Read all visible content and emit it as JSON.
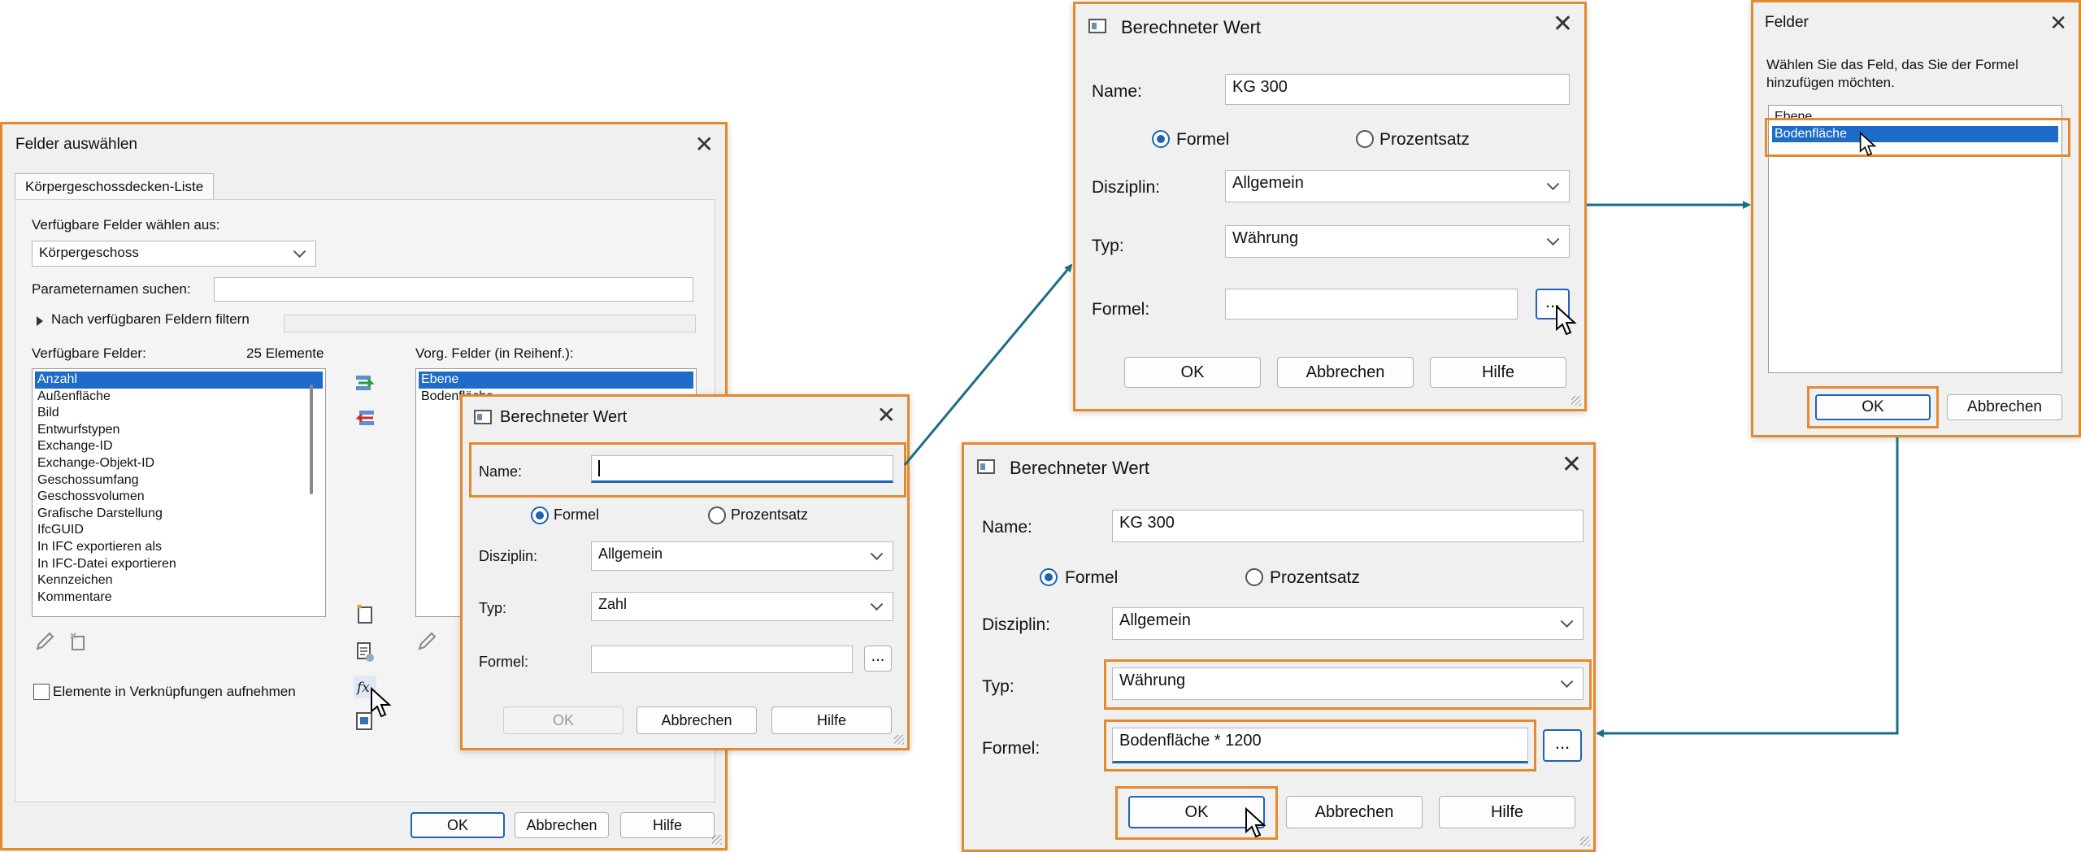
{
  "felder_auswaehlen": {
    "title": "Felder auswählen",
    "tab": "Körpergeschossdecken-Liste",
    "source_label": "Verfügbare Felder wählen aus:",
    "source_value": "Körpergeschoss",
    "search_label": "Parameternamen suchen:",
    "search_value": "",
    "filter_label": "Nach verfügbaren Feldern filtern",
    "available_label": "Verfügbare Felder:",
    "available_count": "25 Elemente",
    "available_items": [
      "Anzahl",
      "Außenfläche",
      "Bild",
      "Entwurfstypen",
      "Exchange-ID",
      "Exchange-Objekt-ID",
      "Geschossumfang",
      "Geschossvolumen",
      "Grafische Darstellung",
      "IfcGUID",
      "In IFC exportieren als",
      "In IFC-Datei exportieren",
      "Kennzeichen",
      "Kommentare"
    ],
    "scheduled_label": "Vorg. Felder (in Reihenf.):",
    "scheduled_items": [
      "Ebene",
      "Bodenfläche"
    ],
    "include_links_label": "Elemente in Verknüpfungen aufnehmen",
    "ok": "OK",
    "cancel": "Abbrechen",
    "help": "Hilfe"
  },
  "dlg1": {
    "title": "Berechneter Wert",
    "name_label": "Name:",
    "name_value": "",
    "radio_formula": "Formel",
    "radio_percent": "Prozentsatz",
    "discipline_label": "Disziplin:",
    "discipline_value": "Allgemein",
    "type_label": "Typ:",
    "type_value": "Zahl",
    "formula_label": "Formel:",
    "formula_value": "",
    "browse": "...",
    "ok": "OK",
    "cancel": "Abbrechen",
    "help": "Hilfe"
  },
  "dlg2": {
    "title": "Berechneter Wert",
    "name_label": "Name:",
    "name_value": "KG 300",
    "radio_formula": "Formel",
    "radio_percent": "Prozentsatz",
    "discipline_label": "Disziplin:",
    "discipline_value": "Allgemein",
    "type_label": "Typ:",
    "type_value": "Währung",
    "formula_label": "Formel:",
    "formula_value": "",
    "browse": "...",
    "ok": "OK",
    "cancel": "Abbrechen",
    "help": "Hilfe"
  },
  "felder": {
    "title": "Felder",
    "instruction": "Wählen Sie das Feld, das Sie der Formel hinzufügen möchten.",
    "items": [
      "Ebene",
      "Bodenfläche"
    ],
    "ok": "OK",
    "cancel": "Abbrechen"
  },
  "dlg3": {
    "title": "Berechneter Wert",
    "name_label": "Name:",
    "name_value": "KG 300",
    "radio_formula": "Formel",
    "radio_percent": "Prozentsatz",
    "discipline_label": "Disziplin:",
    "discipline_value": "Allgemein",
    "type_label": "Typ:",
    "type_value": "Währung",
    "formula_label": "Formel:",
    "formula_value": "Bodenfläche * 1200",
    "browse": "...",
    "ok": "OK",
    "cancel": "Abbrechen",
    "help": "Hilfe"
  },
  "colors": {
    "highlight": "#e5892e",
    "arrow": "#1a6e88",
    "selection": "#1f6bc8"
  }
}
